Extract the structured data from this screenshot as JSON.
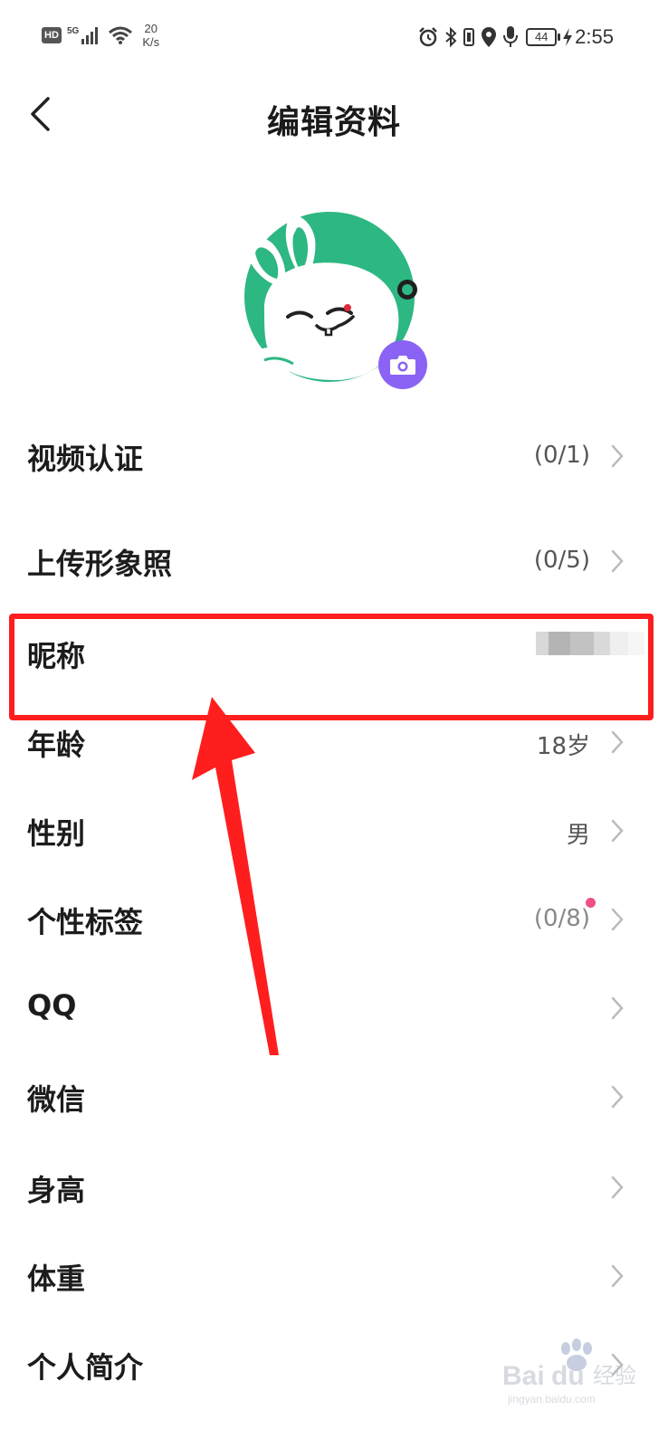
{
  "status_bar": {
    "hd": "HD",
    "network": "5G",
    "speed_value": "20",
    "speed_unit": "K/s",
    "battery": "44",
    "time": "2:55"
  },
  "header": {
    "title": "编辑资料",
    "back_icon": "chevron-left-icon"
  },
  "avatar": {
    "camera_icon": "camera-icon",
    "camera_color": "#8a63f5",
    "avatar_green": "#2db783"
  },
  "rows": [
    {
      "label": "视频认证",
      "value": "(0/1)"
    },
    {
      "label": "上传形象照",
      "value": "(0/5)"
    },
    {
      "label": "昵称",
      "value": ""
    },
    {
      "label": "年龄",
      "value": "18岁"
    },
    {
      "label": "性别",
      "value": "男"
    },
    {
      "label": "个性标签",
      "value": "(0/8)"
    },
    {
      "label": "QQ",
      "value": ""
    },
    {
      "label": "微信",
      "value": ""
    },
    {
      "label": "身高",
      "value": ""
    },
    {
      "label": "体重",
      "value": ""
    },
    {
      "label": "个人简介",
      "value": ""
    }
  ],
  "annotation": {
    "color": "#ff1e1e"
  },
  "watermark": {
    "text": "Baidu经验",
    "subtext": "jingyan.baidu.com"
  }
}
